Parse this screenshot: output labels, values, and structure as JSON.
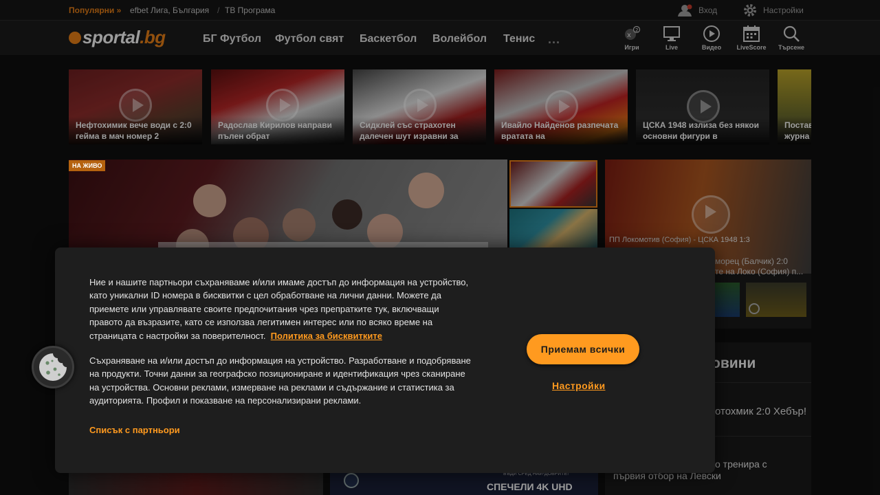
{
  "topbar": {
    "popular_label": "Популярни »",
    "links": [
      "efbet Лига, България",
      "ТВ Програма"
    ],
    "separator": "/",
    "login_label": "Вход",
    "settings_label": "Настройки"
  },
  "nav": {
    "logo_main": "sportal",
    "logo_tld": ".bg",
    "items": [
      "БГ Футбол",
      "Футбол свят",
      "Баскетбол",
      "Волейбол",
      "Тенис"
    ],
    "more": "...",
    "tools": [
      "Игри",
      "Live",
      "Видео",
      "LiveScore",
      "Търсене"
    ]
  },
  "thumbs": [
    {
      "caption": "Нефтохимик вече води с 2:0 гейма в мач номер 2"
    },
    {
      "caption": "Радослав Кирилов направи пълен обрат"
    },
    {
      "caption": "Сидклей със страхотен далечен шут изравни за"
    },
    {
      "caption": "Ивайло Найденов разпечата вратата на"
    },
    {
      "caption": "ЦСКА 1948 излиза без някои основни фигури в"
    },
    {
      "caption": "Постав журна"
    }
  ],
  "hero": {
    "badge": "НА ЖИВО"
  },
  "right_video": {
    "caption": "ПП Локомотив (София) - ЦСКА 1948 1:3",
    "sub1": "морец (Балчик) 2:0",
    "sub2": "те на Локо (София) п..."
  },
  "latest": {
    "title_partial": "овини",
    "items": [
      "отохмик 2:0 Хебър!",
      "о тренира с",
      "първия отбор на Левски"
    ]
  },
  "promo": {
    "text": "СПЕЧЕЛИ 4K UHD",
    "small": "БЪДИ СРЕД НАЙ-ДОБРИТЕ!"
  },
  "cookie": {
    "para1": "Ние и нашите партньори съхраняваме и/или имаме достъп до информация на устройство, като уникални ID номера в бисквитки с цел обработване на лични данни. Можете да приемете или управлявате своите предпочитания чрез препратките тук, включващи правото да възразите, като се използва легитимен интерес или по всяко време на страницата с настройки за поверителност.",
    "policy_link": "Политика за бисквитките",
    "para2": "Съхраняване на и/или достъп до информация на устройство. Разработване и подобряване на продукти. Точни данни за географско позициониране и идентификация чрез сканиране на устройства. Основни реклами, измерване на реклами и съдържание и статистика за аудиторията. Профил и показване на персонализирани реклами.",
    "partners_link": "Списък с партньори",
    "accept_label": "Приемам всички",
    "settings_label": "Настройки"
  },
  "colors": {
    "accent": "#ff9a1f",
    "nav_bg": "#1b1b1b",
    "dialog_bg": "#1e1e1e"
  }
}
